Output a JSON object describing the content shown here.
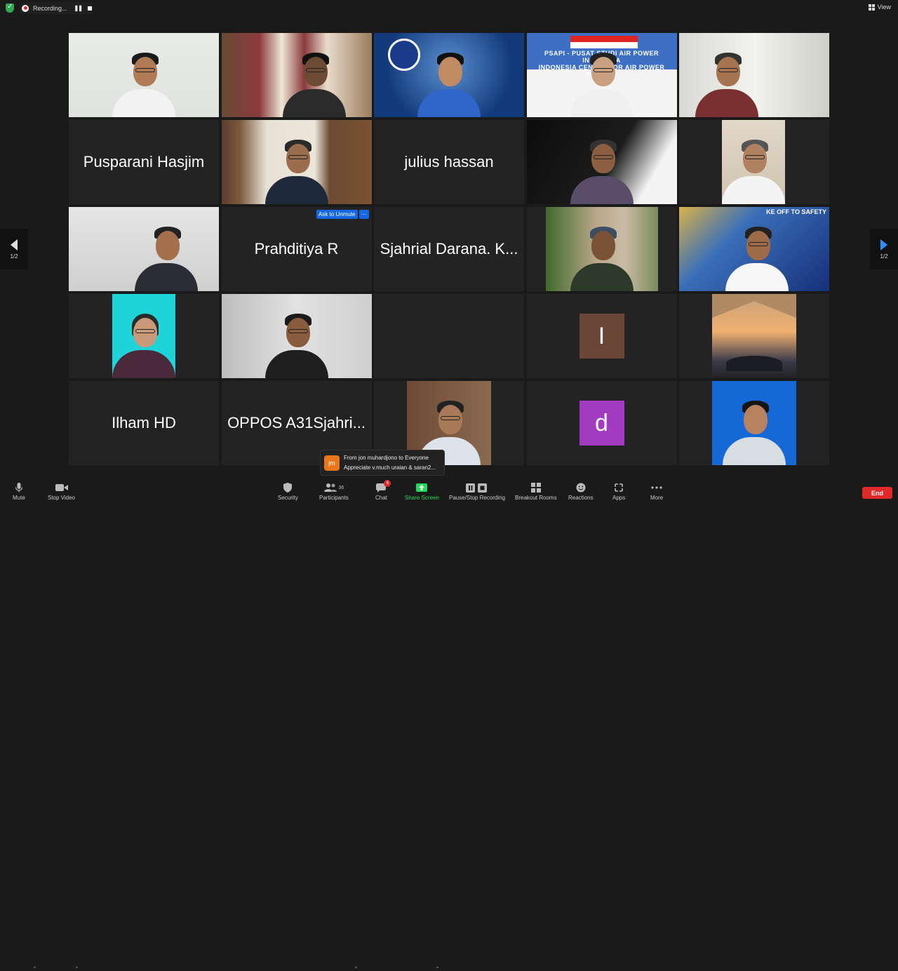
{
  "topbar": {
    "recording_label": "Recording...",
    "pause_glyph": "❚❚",
    "view_label": "View"
  },
  "participants": [
    {
      "name": "",
      "type": "video",
      "active": true
    },
    {
      "name": "",
      "type": "video"
    },
    {
      "name": "",
      "type": "video"
    },
    {
      "name": "",
      "type": "video",
      "overlay": "PSAPI - PUSAT STUDI AIR POWER INDONESIA\nINDONESIA CENTER FOR AIR POWER STUDIES"
    },
    {
      "name": "",
      "type": "video"
    },
    {
      "name": "Pusparani Hasjim",
      "type": "name"
    },
    {
      "name": "",
      "type": "video"
    },
    {
      "name": "julius hassan",
      "type": "name"
    },
    {
      "name": "",
      "type": "video"
    },
    {
      "name": "",
      "type": "video"
    },
    {
      "name": "",
      "type": "video"
    },
    {
      "name": "Prahditiya R",
      "type": "name",
      "ask_unmute": "Ask to Unmute",
      "more": "···"
    },
    {
      "name": "Sjahrial Darana. K...",
      "type": "name"
    },
    {
      "name": "",
      "type": "video"
    },
    {
      "name": "",
      "type": "video",
      "overlay": "KE OFF TO SAFETY"
    },
    {
      "name": "",
      "type": "video"
    },
    {
      "name": "",
      "type": "video"
    },
    {
      "name": "",
      "type": "empty"
    },
    {
      "name": "",
      "type": "initial",
      "initial": "I",
      "color": "#6b4636"
    },
    {
      "name": "",
      "type": "video"
    },
    {
      "name": "Ilham HD",
      "type": "name"
    },
    {
      "name": "OPPOS A31Sjahri...",
      "type": "name"
    },
    {
      "name": "",
      "type": "video"
    },
    {
      "name": "",
      "type": "initial",
      "initial": "d",
      "color": "#a23bc0"
    },
    {
      "name": "",
      "type": "video"
    }
  ],
  "nav": {
    "page_left": "1/2",
    "page_right": "1/2"
  },
  "chat_toast": {
    "avatar": "jm",
    "line1": "From jon muhardjono to Everyone",
    "line2": "Appreciate v.much uraian & saran2..."
  },
  "toolbar": {
    "mute": "Mute",
    "stop_video": "Stop Video",
    "security": "Security",
    "participants": "Participants",
    "participants_count": "36",
    "chat": "Chat",
    "chat_badge": "6",
    "share_screen": "Share Screen",
    "pause_recording": "Pause/Stop Recording",
    "breakout_rooms": "Breakout Rooms",
    "reactions": "Reactions",
    "apps": "Apps",
    "more": "More",
    "end": "End"
  },
  "colors": {
    "accent_green": "#23d959",
    "share_green": "#23d959",
    "end_red": "#e02828",
    "blue": "#2d8cff"
  }
}
